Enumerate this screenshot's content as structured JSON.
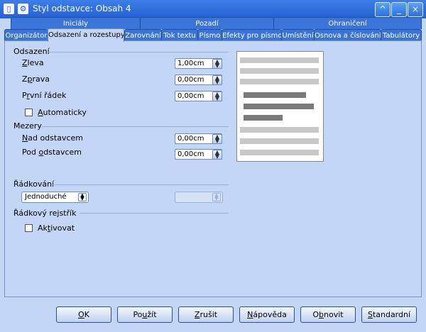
{
  "window": {
    "title": "Styl odstavce: Obsah 4",
    "controls": {
      "help": "^",
      "minimize": "_",
      "close": "×"
    }
  },
  "tabs_top": [
    {
      "label": "Iniciály"
    },
    {
      "label": "Pozadí"
    },
    {
      "label": "Ohraničení"
    }
  ],
  "tabs": [
    {
      "label": "Organizátor"
    },
    {
      "label": "Odsazení a rozestupy"
    },
    {
      "label": "Zarovnání"
    },
    {
      "label": "Tok textu"
    },
    {
      "label": "Písmo"
    },
    {
      "label": "Efekty pro písmo"
    },
    {
      "label": "Umístění"
    },
    {
      "label": "Osnova a číslování"
    },
    {
      "label": "Tabulátory"
    }
  ],
  "indent": {
    "heading": "Odsazení",
    "left": {
      "label_u": "Z",
      "label_rest": "leva",
      "value": "1,00cm"
    },
    "right": {
      "label_pre": "Z",
      "label_u": "p",
      "label_rest": "rava",
      "value": "0,00cm"
    },
    "first": {
      "label_pre": "P",
      "label_u": "r",
      "label_rest": "vní řádek",
      "value": "0,00cm"
    },
    "auto": {
      "label_u": "A",
      "label_rest": "utomaticky"
    }
  },
  "spacing": {
    "heading": "Mezery",
    "above": {
      "label_u": "N",
      "label_rest": "ad odstavcem",
      "value": "0,00cm"
    },
    "below": {
      "label_pre": "Pod ",
      "label_u": "o",
      "label_rest": "dstavcem",
      "value": "0,00cm"
    }
  },
  "line_spacing": {
    "heading": "Řádkování",
    "value": "Jednoduché"
  },
  "register": {
    "heading": "Řádkový rejstřík",
    "activate": {
      "label_pre": "Ak",
      "label_u": "t",
      "label_rest": "ivovat"
    }
  },
  "buttons": {
    "ok": {
      "u": "O",
      "rest": "K"
    },
    "apply": {
      "pre": "Po",
      "u": "u",
      "rest": "žít"
    },
    "reset": {
      "pre": "",
      "u": "Z",
      "rest": "rušit"
    },
    "help": {
      "pre": "",
      "u": "N",
      "rest": "ápověda"
    },
    "restore": {
      "pre": "O",
      "u": "b",
      "rest": "novit"
    },
    "standard": {
      "pre": "",
      "u": "S",
      "rest": "tandardní"
    }
  }
}
